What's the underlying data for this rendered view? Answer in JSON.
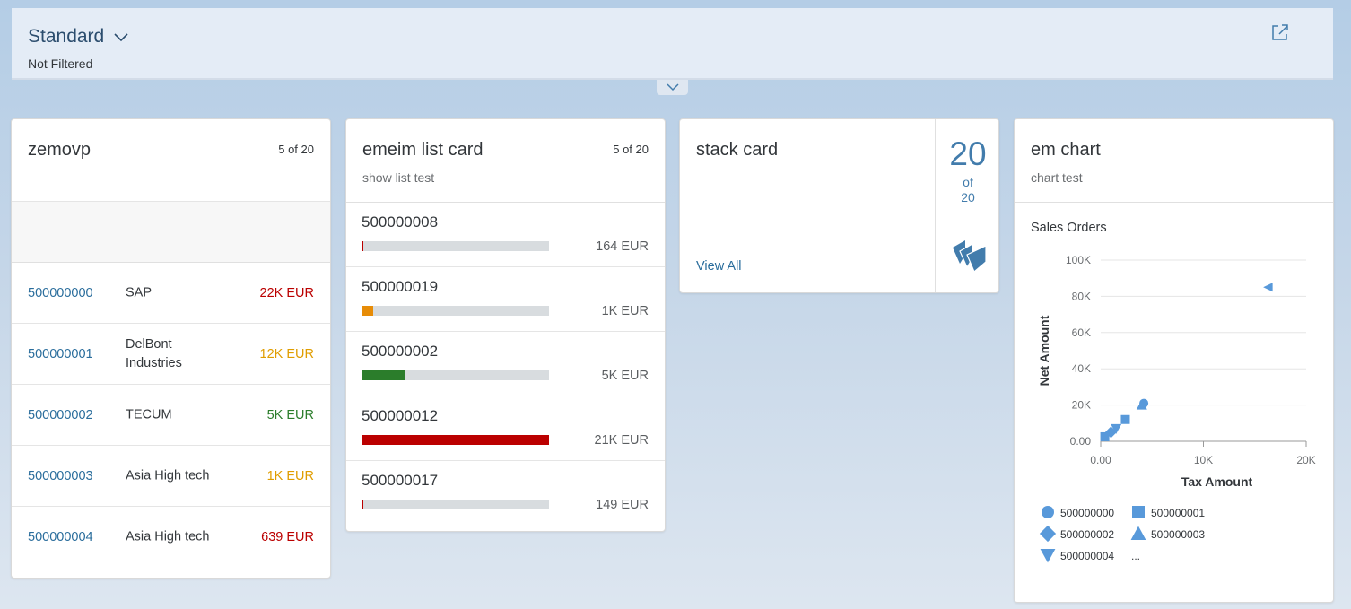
{
  "header": {
    "variant": "Standard",
    "filter_status": "Not Filtered"
  },
  "cards": {
    "table": {
      "title": "zemovp",
      "count": "5 of 20",
      "rows": [
        {
          "id": "500000000",
          "name": "SAP",
          "amount": "22K EUR",
          "color": "#bb0000"
        },
        {
          "id": "500000001",
          "name": "DelBont Industries",
          "amount": "12K EUR",
          "color": "#e09d00"
        },
        {
          "id": "500000002",
          "name": "TECUM",
          "amount": "5K EUR",
          "color": "#2b7d2b"
        },
        {
          "id": "500000003",
          "name": "Asia High tech",
          "amount": "1K EUR",
          "color": "#e09d00"
        },
        {
          "id": "500000004",
          "name": "Asia High tech",
          "amount": "639 EUR",
          "color": "#bb0000"
        }
      ]
    },
    "list": {
      "title": "emeim list card",
      "subtitle": "show list test",
      "count": "5 of 20",
      "items": [
        {
          "id": "500000008",
          "amount": "164 EUR",
          "progress": 0.01,
          "color": "#bb0000"
        },
        {
          "id": "500000019",
          "amount": "1K EUR",
          "progress": 0.06,
          "color": "#e78c07"
        },
        {
          "id": "500000002",
          "amount": "5K EUR",
          "progress": 0.23,
          "color": "#2b7d2b"
        },
        {
          "id": "500000012",
          "amount": "21K EUR",
          "progress": 1.0,
          "color": "#bb0000"
        },
        {
          "id": "500000017",
          "amount": "149 EUR",
          "progress": 0.01,
          "color": "#bb0000"
        }
      ]
    },
    "stack": {
      "title": "stack card",
      "link": "View All",
      "number": "20",
      "of_label": "of",
      "total": "20"
    },
    "chart": {
      "title": "em chart",
      "subtitle": "chart test"
    }
  },
  "chart_data": {
    "type": "scatter",
    "title": "Sales Orders",
    "xlabel": "Tax Amount",
    "ylabel": "Net Amount",
    "xlim": [
      0,
      20000
    ],
    "ylim": [
      0,
      100000
    ],
    "x_ticks": [
      "0.00",
      "10K",
      "20K"
    ],
    "y_ticks": [
      "0.00",
      "20K",
      "40K",
      "60K",
      "80K",
      "100K"
    ],
    "grid": true,
    "legend_position": "bottom",
    "color": "#5899da",
    "series": [
      {
        "name": "500000000",
        "shape": "circle",
        "points": [
          [
            4200,
            21000
          ]
        ]
      },
      {
        "name": "500000001",
        "shape": "square",
        "points": [
          [
            400,
            2500
          ],
          [
            2400,
            12000
          ]
        ]
      },
      {
        "name": "500000002",
        "shape": "diamond",
        "points": [
          [
            1000,
            5000
          ]
        ]
      },
      {
        "name": "500000003",
        "shape": "triangle-up",
        "points": [
          [
            4000,
            20000
          ]
        ]
      },
      {
        "name": "500000004",
        "shape": "triangle-down",
        "points": [
          [
            1500,
            7000
          ]
        ]
      },
      {
        "name": "...",
        "shape": "triangle-left",
        "points": [
          [
            16300,
            85000
          ]
        ]
      }
    ],
    "legend": [
      "500000000",
      "500000001",
      "500000002",
      "500000003",
      "500000004",
      "..."
    ]
  }
}
